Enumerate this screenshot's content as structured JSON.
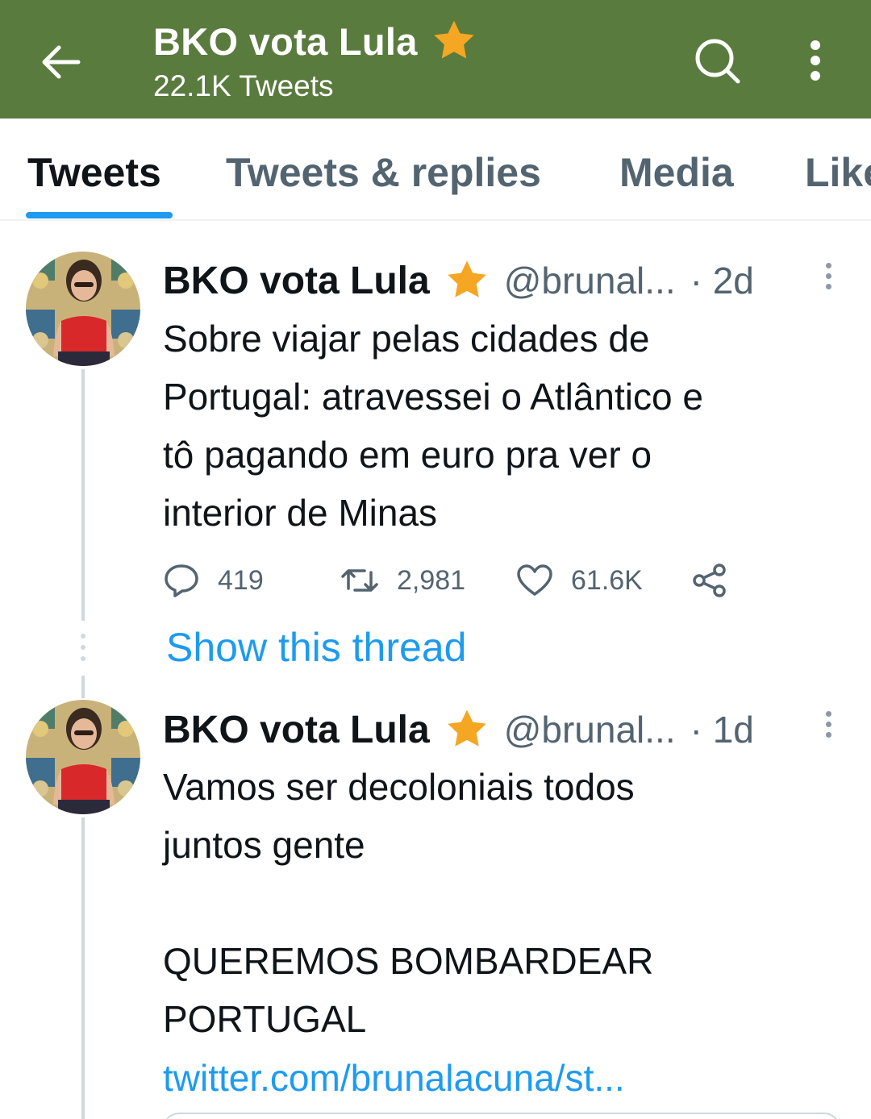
{
  "header": {
    "title": "BKO vota Lula",
    "tweet_count": "22.1K Tweets",
    "back_icon": "arrow-left-icon",
    "search_icon": "search-icon",
    "more_icon": "vertical-dots-icon",
    "background_color": "#5a7b3e"
  },
  "tabs": [
    {
      "label": "Tweets",
      "active": true
    },
    {
      "label": "Tweets & replies",
      "active": false
    },
    {
      "label": "Media",
      "active": false
    },
    {
      "label": "Likes",
      "active": false
    }
  ],
  "tweets": [
    {
      "display_name": "BKO vota Lula",
      "handle": "@brunal...",
      "time": "· 2d",
      "text": "Sobre viajar pelas cidades de\nPortugal: atravessei o Atlântico e\ntô pagando em euro pra ver o\ninterior de Minas",
      "replies": "419",
      "retweets": "2,981",
      "likes": "61.6K",
      "show_thread": "Show this thread"
    },
    {
      "display_name": "BKO vota Lula",
      "handle": "@brunal...",
      "time": "· 1d",
      "text": "Vamos ser decoloniais todos\njuntos gente\n\nQUEREMOS BOMBARDEAR\nPORTUGAL",
      "link": "twitter.com/brunalacuna/st..."
    }
  ],
  "colors": {
    "accent": "#1d9bf0",
    "star": "#f5a623",
    "secondary_text": "#536471"
  }
}
